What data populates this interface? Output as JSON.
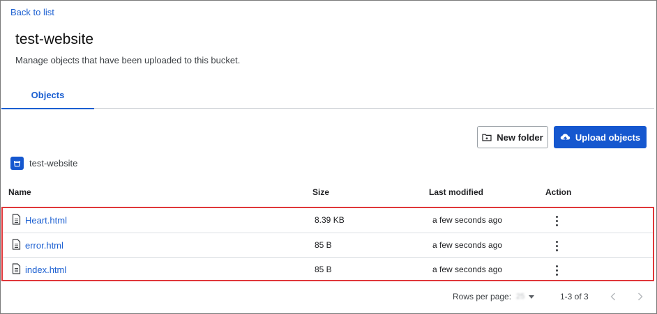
{
  "nav": {
    "back_label": "Back to list"
  },
  "header": {
    "title": "test-website",
    "description": "Manage objects that have been uploaded to this bucket."
  },
  "tabs": [
    {
      "label": "Objects",
      "active": true
    }
  ],
  "toolbar": {
    "new_folder_label": "New folder",
    "new_folder_icon": "folder-plus-icon",
    "upload_label": "Upload objects",
    "upload_icon": "cloud-upload-icon"
  },
  "breadcrumb": {
    "bucket_label": "test-website",
    "icon": "bucket-icon"
  },
  "table": {
    "columns": {
      "name": "Name",
      "size": "Size",
      "modified": "Last modified",
      "action": "Action"
    },
    "rows": [
      {
        "name": "Heart.html",
        "size": "8.39 KB",
        "modified": "a few seconds ago"
      },
      {
        "name": "error.html",
        "size": "85 B",
        "modified": "a few seconds ago"
      },
      {
        "name": "index.html",
        "size": "85 B",
        "modified": "a few seconds ago"
      }
    ]
  },
  "pagination": {
    "rows_per_page_label": "Rows per page:",
    "rows_per_page_value": "25",
    "range_label": "1-3 of 3"
  },
  "colors": {
    "accent": "#1557cf",
    "link": "#1b5fd1",
    "highlight_border": "#e0373a"
  }
}
